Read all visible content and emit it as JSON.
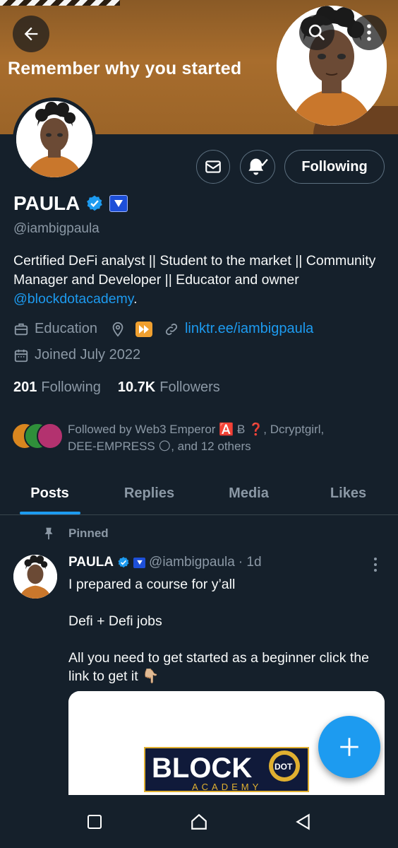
{
  "banner": {
    "text": "Remember why you started"
  },
  "header_actions": {
    "back": "arrow-left-icon",
    "search": "search-icon",
    "more": "more-vertical-icon"
  },
  "profile": {
    "name": "PAULA",
    "handle": "@iambigpaula",
    "bio_text": "Certified DeFi analyst || Student to the market || Community Manager and Developer || Educator and owner ",
    "bio_mention": "@blockdotacademy",
    "bio_end": ".",
    "category": "Education",
    "link": "linktr.ee/iambigpaula",
    "joined": "Joined July 2022",
    "following_count": "201",
    "following_label": "Following",
    "followers_count": "10.7K",
    "followers_label": "Followers",
    "followed_by": "Followed by Web3 Emperor 🅰️ Ƀ ❓, Dcryptgirl, DEE-EMPRESS 🌕, and 12 others"
  },
  "actions": {
    "following_button": "Following"
  },
  "tabs": [
    {
      "label": "Posts",
      "active": true
    },
    {
      "label": "Replies",
      "active": false
    },
    {
      "label": "Media",
      "active": false
    },
    {
      "label": "Likes",
      "active": false
    }
  ],
  "pinned_post": {
    "pinned_label": "Pinned",
    "author": "PAULA",
    "handle": "@iambigpaula",
    "time": "· 1d",
    "lines": [
      "I prepared a course for y’all",
      "Defi + Defi jobs",
      "All you need to get started as a beginner click the link to get it 👇🏼"
    ],
    "media_logo_main": "BLOCK",
    "media_logo_dot": "DOT",
    "media_logo_sub": "ACADEMY"
  },
  "colors": {
    "background": "#15202b",
    "accent": "#1d9bf0",
    "muted": "#8b98a5",
    "border": "#38444d"
  }
}
